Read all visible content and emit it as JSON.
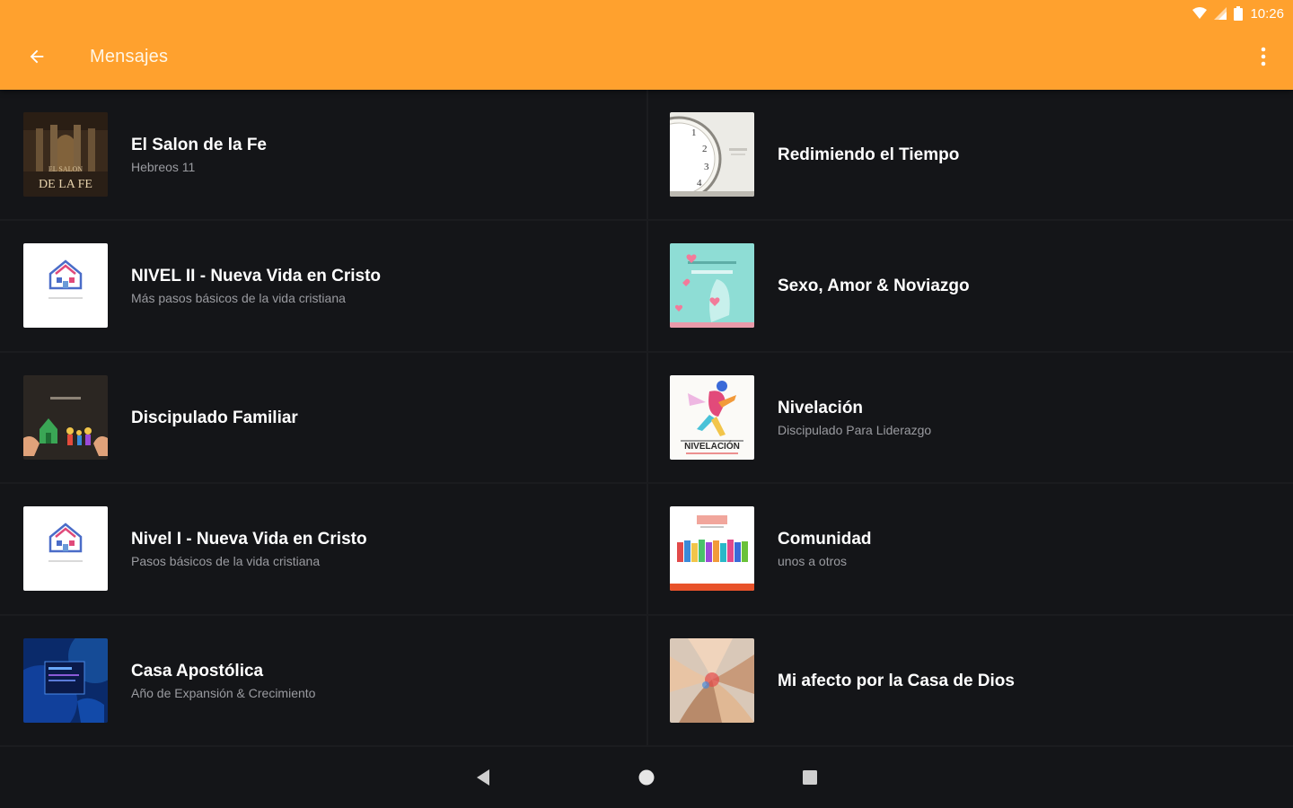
{
  "status_bar": {
    "time": "10:26"
  },
  "app_bar": {
    "title": "Mensajes",
    "accent": "#FFA12E",
    "back_icon": "arrow-left-icon",
    "menu_icon": "more-vertical-icon"
  },
  "items": [
    {
      "title": "El Salon de la Fe",
      "subtitle": "Hebreos 11",
      "thumb_text": "DE LA FE"
    },
    {
      "title": "Redimiendo el Tiempo",
      "subtitle": ""
    },
    {
      "title": "NIVEL II - Nueva Vida en Cristo",
      "subtitle": "Más pasos básicos de la vida cristiana"
    },
    {
      "title": "Sexo, Amor & Noviazgo",
      "subtitle": ""
    },
    {
      "title": "Discipulado Familiar",
      "subtitle": ""
    },
    {
      "title": "Nivelación",
      "subtitle": "Discipulado Para Liderazgo",
      "thumb_text": "NIVELACIÓN"
    },
    {
      "title": "Nivel I - Nueva Vida en Cristo",
      "subtitle": "Pasos básicos de la vida cristiana"
    },
    {
      "title": "Comunidad",
      "subtitle": "unos a otros"
    },
    {
      "title": "Casa Apostólica",
      "subtitle": "Año de Expansión & Crecimiento"
    },
    {
      "title": "Mi afecto por la Casa de Dios",
      "subtitle": ""
    }
  ],
  "nav_bar": {
    "back_icon": "triangle-back-icon",
    "home_icon": "circle-home-icon",
    "recents_icon": "square-recents-icon"
  }
}
